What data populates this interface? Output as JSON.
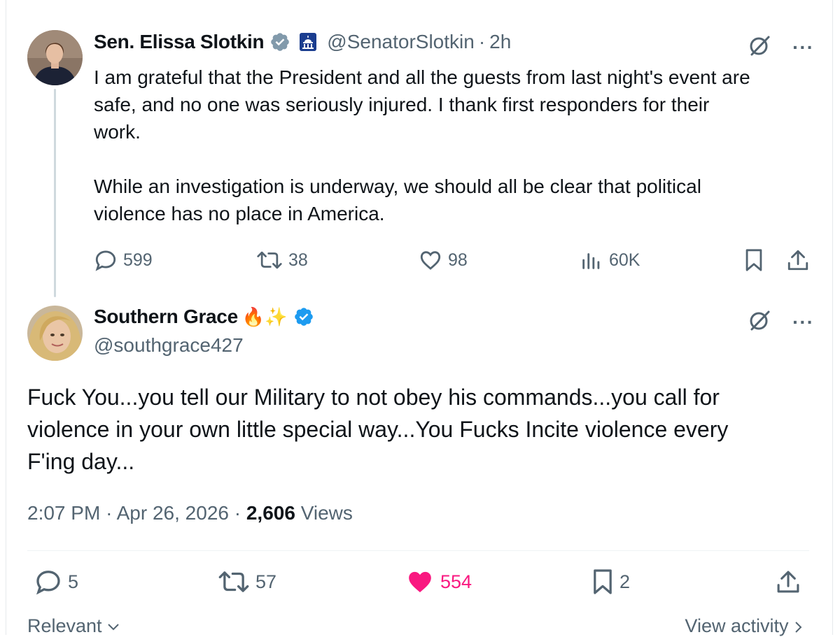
{
  "parent_tweet": {
    "display_name": "Sen. Elissa Slotkin",
    "handle": "@SenatorSlotkin",
    "separator": "·",
    "time_ago": "2h",
    "body": "I am grateful that the President and all the guests from last night's event are\nsafe, and no one was seriously injured. I thank first responders for their\nwork.\n\nWhile an investigation is underway, we should all be clear that political\nviolence has no place in America.",
    "stats": {
      "replies": "599",
      "reposts": "38",
      "likes": "98",
      "views": "60K"
    },
    "badges": [
      "verified-gray-icon",
      "capitol-flag-icon"
    ]
  },
  "reply_tweet": {
    "display_name": "Southern Grace",
    "name_emojis": "🔥✨",
    "handle": "@southgrace427",
    "body": "Fuck You...you tell our Military to not obey his commands...you call for\nviolence in your own little special way...You Fucks Incite violence every\nF'ing day...",
    "time": "2:07 PM",
    "date": "Apr 26, 2026",
    "views_count": "2,606",
    "views_label": "Views",
    "separator": "·",
    "stats": {
      "replies": "5",
      "reposts": "57",
      "likes": "554",
      "bookmarks": "2"
    },
    "badges": [
      "verified-blue-icon"
    ]
  },
  "footer": {
    "sort_label": "Relevant",
    "activity_label": "View activity"
  },
  "colors": {
    "text": "#0f1419",
    "secondary": "#536471",
    "verified_blue": "#1d9bf0",
    "verified_gray": "#829aab",
    "like_pink": "#f91880",
    "thread_line": "#cfd9de"
  },
  "icons": [
    "grok-icon",
    "more-icon",
    "reply-icon",
    "repost-icon",
    "like-icon",
    "views-icon",
    "bookmark-icon",
    "share-icon",
    "chevron-down-icon",
    "chevron-right-icon"
  ]
}
